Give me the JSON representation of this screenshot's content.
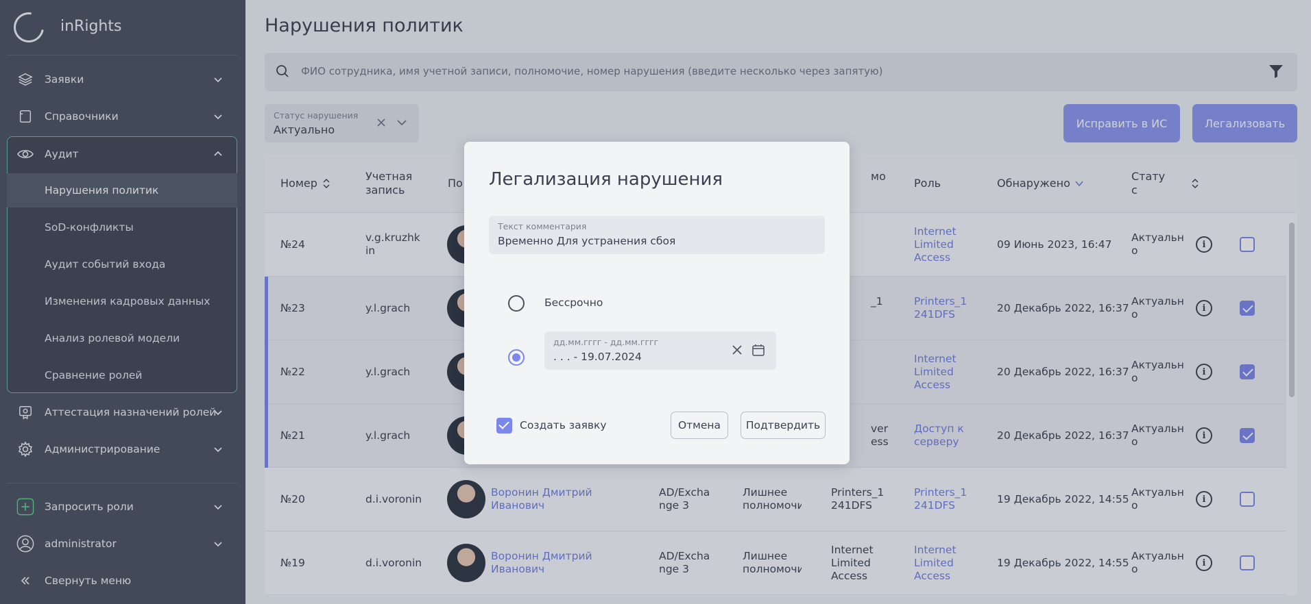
{
  "app": {
    "name": "inRights"
  },
  "sidebar": {
    "items": [
      {
        "label": "Заявки",
        "icon": "layers-icon"
      },
      {
        "label": "Справочники",
        "icon": "book-icon"
      },
      {
        "label": "Аудит",
        "icon": "eye-icon"
      }
    ],
    "audit_sub": [
      {
        "label": "Нарушения политик"
      },
      {
        "label": "SoD-конфликты"
      },
      {
        "label": "Аудит событий входа"
      },
      {
        "label": "Изменения кадровых данных"
      },
      {
        "label": "Анализ ролевой модели"
      },
      {
        "label": "Сравнение ролей"
      }
    ],
    "items2": [
      {
        "label": "Аттестация назначений ролей",
        "icon": "certificate-icon"
      },
      {
        "label": "Администрирование",
        "icon": "gear-icon"
      }
    ],
    "request_roles": "Запросить роли",
    "user": "administrator",
    "collapse": "Свернуть меню"
  },
  "main": {
    "title": "Нарушения политик",
    "search_placeholder": "ФИО сотрудника, имя учетной записи, полномочие, номер нарушения (введите несколько через запятую)",
    "status_filter": {
      "label": "Статус нарушения",
      "value": "Актуально"
    },
    "fix_button": "Исправить в ИС",
    "legalize_button": "Легализовать"
  },
  "table": {
    "headers": {
      "number": "Номер",
      "account": "Учетная запись",
      "user": "По",
      "permission": "мо",
      "role": "Роль",
      "detected": "Обнаружено",
      "status": "Стату с"
    },
    "rows": [
      {
        "num": "№24",
        "account": "v.g.kruzhkin",
        "name": "",
        "system": "",
        "type": "",
        "perm": "",
        "role": "Internet Limited Access",
        "date": "09 Июнь 2023, 16:47",
        "status": "Актуально",
        "checked": false,
        "selected": false
      },
      {
        "num": "№23",
        "account": "y.l.grach",
        "name": "",
        "system": "",
        "type": "",
        "perm": "_1",
        "role": "Printers_1 241DFS",
        "date": "20 Декабрь 2022, 16:37",
        "status": "Актуально",
        "checked": true,
        "selected": true
      },
      {
        "num": "№22",
        "account": "y.l.grach",
        "name": "",
        "system": "",
        "type": "",
        "perm": "",
        "role": "Internet Limited Access",
        "date": "20 Декабрь 2022, 16:37",
        "status": "Актуально",
        "checked": true,
        "selected": true
      },
      {
        "num": "№21",
        "account": "y.l.grach",
        "name": "",
        "system": "",
        "type": "",
        "perm": "ver ess",
        "role": "Доступ к серверу",
        "date": "20 Декабрь 2022, 16:37",
        "status": "Актуально",
        "checked": true,
        "selected": true
      },
      {
        "num": "№20",
        "account": "d.i.voronin",
        "name": "Воронин Дмитрий Иванович",
        "system": "AD/Exchange 3",
        "type": "Лишнее полномочие",
        "perm": "Printers_1 241DFS",
        "role": "Printers_1 241DFS",
        "date": "19 Декабрь 2022, 14:55",
        "status": "Актуально",
        "checked": false,
        "selected": false
      },
      {
        "num": "№19",
        "account": "d.i.voronin",
        "name": "Воронин Дмитрий Иванович",
        "system": "AD/Exchange 3",
        "type": "Лишнее полномочие",
        "perm": "Internet Limited Access",
        "role": "Internet Limited Access",
        "date": "19 Декабрь 2022, 14:55",
        "status": "Актуально",
        "checked": false,
        "selected": false
      }
    ]
  },
  "modal": {
    "title": "Легализация нарушения",
    "comment_label": "Текст комментария",
    "comment_value": "Временно Для устранения сбоя",
    "radio_forever": "Бессрочно",
    "date_label": "дд.мм.гггг - дд.мм.гггг",
    "date_value": ". . . - 19.07.2024",
    "create_request": "Создать заявку",
    "cancel": "Отмена",
    "confirm": "Подтвердить"
  },
  "colors": {
    "accent": "#7b87ea",
    "sidebar": "#49505e",
    "link": "#6f7ee0"
  }
}
